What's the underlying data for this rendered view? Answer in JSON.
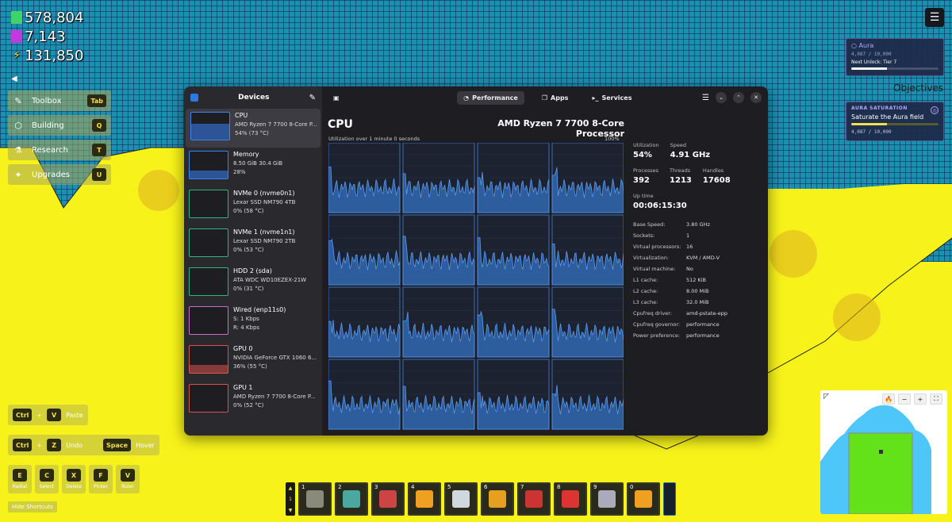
{
  "resources": [
    {
      "icon": "green-block-icon",
      "value": "578,804",
      "color": "#3fd46a"
    },
    {
      "icon": "purple-flag-icon",
      "value": "7,143",
      "color": "#c23adf"
    },
    {
      "icon": "lightning-icon",
      "value": "131,850",
      "color": "#f4e04a"
    }
  ],
  "menu": [
    {
      "icon": "wrench-icon",
      "glyph": "🔧",
      "label": "Toolbox",
      "key": "Tab"
    },
    {
      "icon": "cube-icon",
      "glyph": "⬡",
      "label": "Building",
      "key": "Q"
    },
    {
      "icon": "flask-icon",
      "glyph": "⚗",
      "label": "Research",
      "key": "T"
    },
    {
      "icon": "sparkle-icon",
      "glyph": "✦",
      "label": "Upgrades",
      "key": "U"
    }
  ],
  "aura": {
    "title": "Aura",
    "value": "4,087 / 10,000",
    "unlock": "Next Unlock: Tier 7",
    "progress": 0.41
  },
  "objectives": {
    "heading": "Objectives",
    "card_title": "AURA SATURATION",
    "desc": "Saturate the Aura field",
    "value": "4,087 / 10,000",
    "progress": 0.41
  },
  "shortcuts": {
    "paste": {
      "keys": [
        "Ctrl",
        "V"
      ],
      "label": "Paste"
    },
    "undo": {
      "keys": [
        "Ctrl",
        "Z"
      ],
      "label": "Undo"
    },
    "hover": {
      "key": "Space",
      "label": "Hover"
    },
    "tools": [
      {
        "key": "E",
        "label": "Radial"
      },
      {
        "key": "C",
        "label": "Select"
      },
      {
        "key": "X",
        "label": "Delete"
      },
      {
        "key": "F",
        "label": "Picker"
      },
      {
        "key": "V",
        "label": "Ruler"
      }
    ],
    "hide_label": "Hide Shortcuts"
  },
  "hotbar": {
    "scroll": [
      "▲",
      "1",
      "▼"
    ],
    "slots": [
      {
        "num": "1",
        "icon": "gems-icon",
        "color": "#8a8a7a"
      },
      {
        "num": "2",
        "icon": "magnet-icon",
        "color": "#4aa8a0"
      },
      {
        "num": "3",
        "icon": "syringe-icon",
        "color": "#c44"
      },
      {
        "num": "4",
        "icon": "orange-block-icon",
        "color": "#f0a020"
      },
      {
        "num": "5",
        "icon": "spark-icon",
        "color": "#cfd8dc"
      },
      {
        "num": "6",
        "icon": "firework-icon",
        "color": "#e6a020"
      },
      {
        "num": "7",
        "icon": "tv-icon",
        "color": "#c33"
      },
      {
        "num": "8",
        "icon": "circuit-icon",
        "color": "#d33"
      },
      {
        "num": "9",
        "icon": "play-icon",
        "color": "#aab"
      },
      {
        "num": "0",
        "icon": "barrier-icon",
        "color": "#f0a020"
      }
    ]
  },
  "minimap": {
    "buttons": [
      "🔥",
      "−",
      "+",
      "⛶"
    ]
  },
  "monitor": {
    "sidebar_title": "Devices",
    "tabs": [
      {
        "icon": "gauge-icon",
        "glyph": "◔",
        "label": "Performance"
      },
      {
        "icon": "apps-icon",
        "glyph": "❐",
        "label": "Apps"
      },
      {
        "icon": "terminal-icon",
        "glyph": "▸_",
        "label": "Services"
      }
    ],
    "devices": [
      {
        "name": "CPU",
        "sub": "AMD Ryzen 7 7700 8-Core P...",
        "stat": "54% (73 °C)",
        "color": "#3b82f6"
      },
      {
        "name": "Memory",
        "sub": "8.50 GiB 30.4 GiB",
        "stat": "28%",
        "color": "#3b82f6"
      },
      {
        "name": "NVMe 0 (nvme0n1)",
        "sub": "Lexar SSD NM790 4TB",
        "stat": "0% (58 °C)",
        "color": "#2db87a"
      },
      {
        "name": "NVMe 1 (nvme1n1)",
        "sub": "Lexar SSD NM790 2TB",
        "stat": "0% (53 °C)",
        "color": "#2db87a"
      },
      {
        "name": "HDD 2 (sda)",
        "sub": "ATA WDC WD10EZEX-21W",
        "stat": "0% (31 °C)",
        "color": "#2db87a"
      },
      {
        "name": "Wired (enp11s0)",
        "sub": "S: 1 Kbps",
        "stat": "R: 4 Kbps",
        "color": "#c86ec8"
      },
      {
        "name": "GPU 0",
        "sub": "NVIDIA GeForce GTX 1060 6...",
        "stat": "36% (55 °C)",
        "color": "#d9534f"
      },
      {
        "name": "GPU 1",
        "sub": "AMD Ryzen 7 7700 8-Core P...",
        "stat": "0% (52 °C)",
        "color": "#d9534f"
      }
    ],
    "title": "CPU",
    "model": "AMD Ryzen 7 7700 8-Core Processor",
    "util_caption": "Utilization over 1 minute 0 seconds",
    "util_max": "100%",
    "stats_top": [
      {
        "label": "Utilization",
        "value": "54%"
      },
      {
        "label": "Speed",
        "value": "4.91 GHz"
      }
    ],
    "stats_mid": [
      {
        "label": "Processes",
        "value": "392"
      },
      {
        "label": "Threads",
        "value": "1213"
      },
      {
        "label": "Handles",
        "value": "17608"
      }
    ],
    "uptime_label": "Up time",
    "uptime_value": "00:06:15:30",
    "details": [
      {
        "k": "Base Speed:",
        "v": "3.80 GHz"
      },
      {
        "k": "Sockets:",
        "v": "1"
      },
      {
        "k": "Virtual processors:",
        "v": "16"
      },
      {
        "k": "Virtualization:",
        "v": "KVM / AMD-V"
      },
      {
        "k": "Virtual machine:",
        "v": "No"
      },
      {
        "k": "L1 cache:",
        "v": "512 KiB"
      },
      {
        "k": "L2 cache:",
        "v": "8.00 MiB"
      },
      {
        "k": "L3 cache:",
        "v": "32.0 MiB"
      },
      {
        "k": "Cpufreq driver:",
        "v": "amd-pstate-epp"
      },
      {
        "k": "Cpufreq governor:",
        "v": "performance"
      },
      {
        "k": "Power preference:",
        "v": "performance"
      }
    ]
  }
}
